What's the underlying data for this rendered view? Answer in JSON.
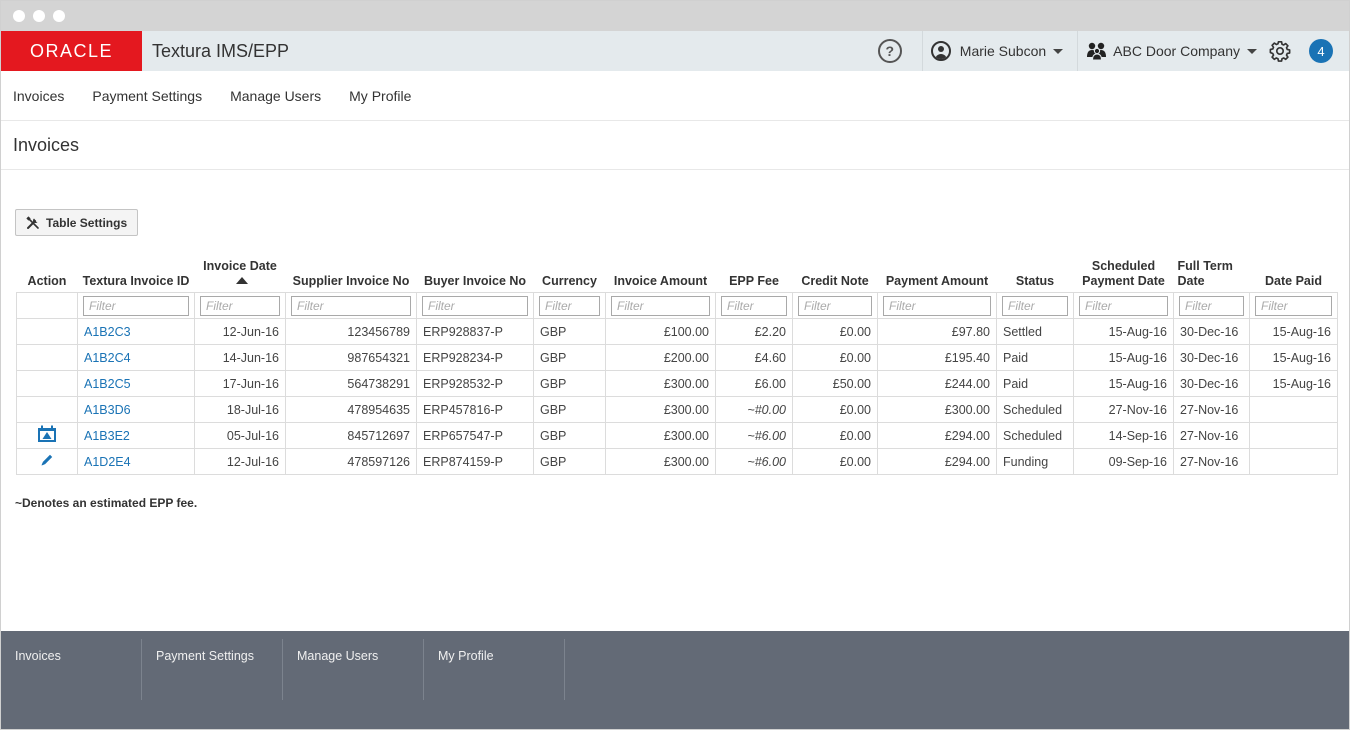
{
  "header": {
    "logo_text": "ORACLE",
    "product_title": "Textura IMS/EPP",
    "help_symbol": "?",
    "user_name": "Marie Subcon",
    "company_name": "ABC Door Company",
    "notification_count": "4",
    "brand_color": "#e4181f",
    "accent_color": "#1a73b5"
  },
  "nav": {
    "items": [
      {
        "label": "Invoices"
      },
      {
        "label": "Payment Settings"
      },
      {
        "label": "Manage Users"
      },
      {
        "label": "My Profile"
      }
    ]
  },
  "page": {
    "title": "Invoices",
    "table_settings_label": "Table Settings",
    "footnote": "~Denotes an estimated EPP fee."
  },
  "table": {
    "filter_placeholder": "Filter",
    "columns": [
      {
        "label": "Action"
      },
      {
        "label": "Textura Invoice ID"
      },
      {
        "label": "Invoice Date"
      },
      {
        "label": "Supplier Invoice No"
      },
      {
        "label": "Buyer Invoice No"
      },
      {
        "label": "Currency"
      },
      {
        "label": "Invoice Amount"
      },
      {
        "label": "EPP Fee"
      },
      {
        "label": "Credit Note"
      },
      {
        "label": "Payment Amount"
      },
      {
        "label": "Status"
      },
      {
        "label": "Scheduled Payment Date"
      },
      {
        "label": "Full Term Date"
      },
      {
        "label": "Date Paid"
      }
    ],
    "rows": [
      {
        "action": "",
        "id": "A1B2C3",
        "invoice_date": "12-Jun-16",
        "supplier_no": "123456789",
        "buyer_no": "ERP928837-P",
        "currency": "GBP",
        "invoice_amount": "£100.00",
        "epp_fee": "£2.20",
        "credit_note": "£0.00",
        "payment_amount": "£97.80",
        "status": "Settled",
        "scheduled_date": "15-Aug-16",
        "full_term": "30-Dec-16",
        "date_paid": "15-Aug-16"
      },
      {
        "action": "",
        "id": "A1B2C4",
        "invoice_date": "14-Jun-16",
        "supplier_no": "987654321",
        "buyer_no": "ERP928234-P",
        "currency": "GBP",
        "invoice_amount": "£200.00",
        "epp_fee": "£4.60",
        "credit_note": "£0.00",
        "payment_amount": "£195.40",
        "status": "Paid",
        "scheduled_date": "15-Aug-16",
        "full_term": "30-Dec-16",
        "date_paid": "15-Aug-16"
      },
      {
        "action": "",
        "id": "A1B2C5",
        "invoice_date": "17-Jun-16",
        "supplier_no": "564738291",
        "buyer_no": "ERP928532-P",
        "currency": "GBP",
        "invoice_amount": "£300.00",
        "epp_fee": "£6.00",
        "credit_note": "£50.00",
        "payment_amount": "£244.00",
        "status": "Paid",
        "scheduled_date": "15-Aug-16",
        "full_term": "30-Dec-16",
        "date_paid": "15-Aug-16"
      },
      {
        "action": "",
        "id": "A1B3D6",
        "invoice_date": "18-Jul-16",
        "supplier_no": "478954635",
        "buyer_no": "ERP457816-P",
        "currency": "GBP",
        "invoice_amount": "£300.00",
        "epp_fee": "~#0.00",
        "credit_note": "£0.00",
        "payment_amount": "£300.00",
        "status": "Scheduled",
        "scheduled_date": "27-Nov-16",
        "full_term": "27-Nov-16",
        "date_paid": ""
      },
      {
        "action": "calendar-alert-icon",
        "id": "A1B3E2",
        "invoice_date": "05-Jul-16",
        "supplier_no": "845712697",
        "buyer_no": "ERP657547-P",
        "currency": "GBP",
        "invoice_amount": "£300.00",
        "epp_fee": "~#6.00",
        "credit_note": "£0.00",
        "payment_amount": "£294.00",
        "status": "Scheduled",
        "scheduled_date": "14-Sep-16",
        "full_term": "27-Nov-16",
        "date_paid": ""
      },
      {
        "action": "pencil-icon",
        "id": "A1D2E4",
        "invoice_date": "12-Jul-16",
        "supplier_no": "478597126",
        "buyer_no": "ERP874159-P",
        "currency": "GBP",
        "invoice_amount": "£300.00",
        "epp_fee": "~#6.00",
        "credit_note": "£0.00",
        "payment_amount": "£294.00",
        "status": "Funding",
        "scheduled_date": "09-Sep-16",
        "full_term": "27-Nov-16",
        "date_paid": ""
      }
    ]
  },
  "footer": {
    "items": [
      {
        "label": "Invoices"
      },
      {
        "label": "Payment Settings"
      },
      {
        "label": "Manage Users"
      },
      {
        "label": "My Profile"
      }
    ]
  }
}
